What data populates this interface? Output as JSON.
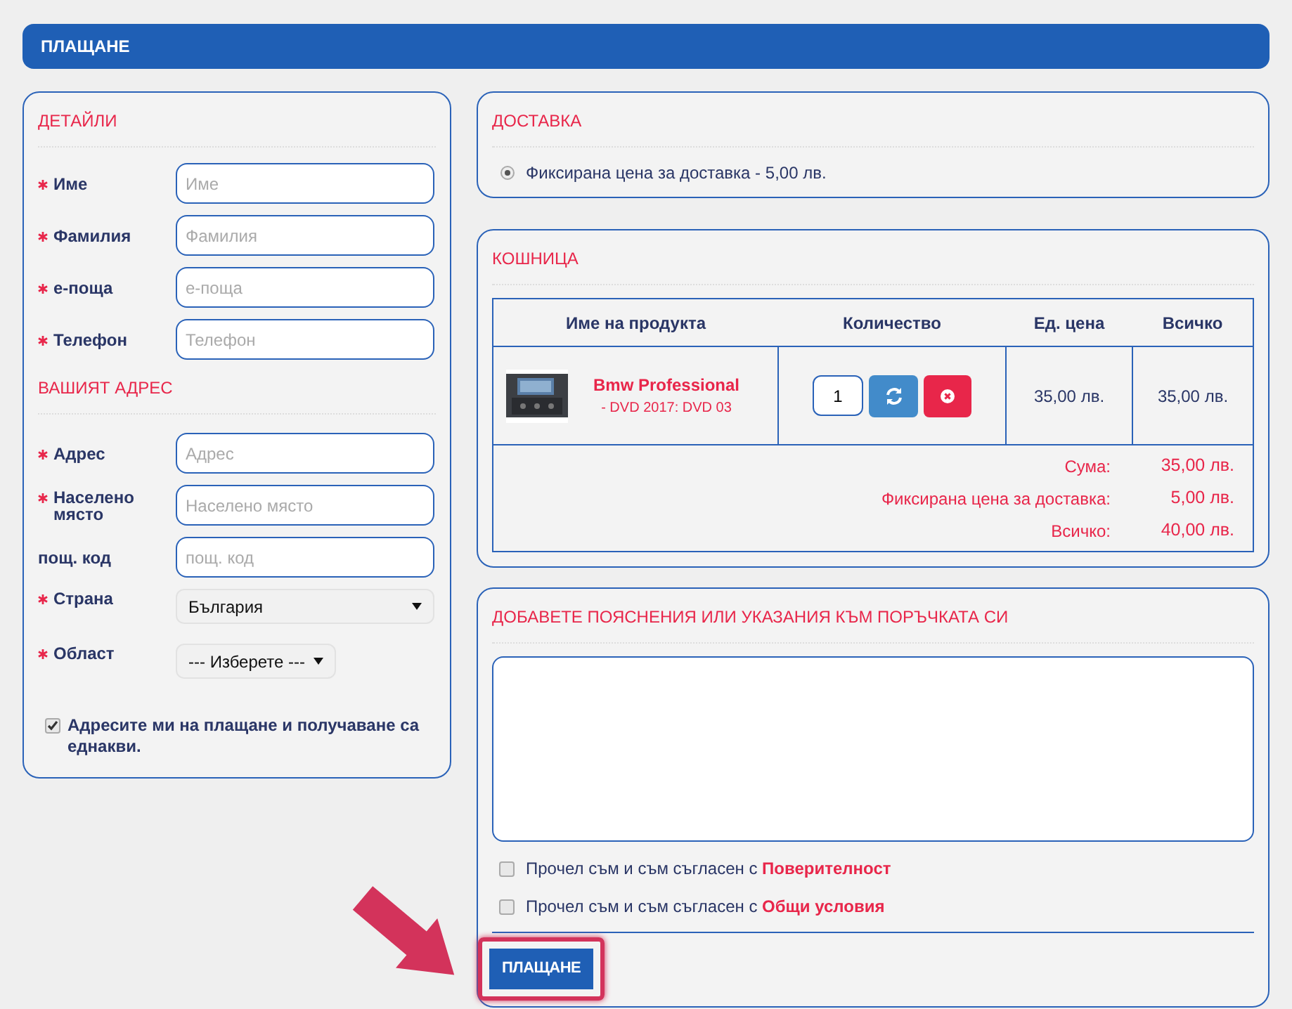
{
  "header": {
    "title": "ПЛАЩАНЕ"
  },
  "details": {
    "title": "ДЕТАЙЛИ",
    "fields": [
      {
        "label": "Име",
        "placeholder": "Име",
        "required": true
      },
      {
        "label": "Фамилия",
        "placeholder": "Фамилия",
        "required": true
      },
      {
        "label": "е-поща",
        "placeholder": "е-поща",
        "required": true
      },
      {
        "label": "Телефон",
        "placeholder": "Телефон",
        "required": true
      }
    ]
  },
  "address": {
    "title": "ВАШИЯТ АДРЕС",
    "fields": [
      {
        "kind": "text",
        "label": "Адрес",
        "placeholder": "Адрес",
        "required": true
      },
      {
        "kind": "text",
        "label": "Населено място",
        "placeholder": "Населено място",
        "required": true
      },
      {
        "kind": "text",
        "label": "пощ. код",
        "placeholder": "пощ. код",
        "required": false
      },
      {
        "kind": "select",
        "label": "Страна",
        "value": "България",
        "required": true,
        "wide": true
      },
      {
        "kind": "select",
        "label": "Област",
        "value": "--- Изберете ---",
        "required": true,
        "wide": false
      }
    ]
  },
  "same_address": {
    "label": "Адресите ми на плащане и получаване са еднакви.",
    "checked": true
  },
  "delivery": {
    "title": "ДОСТАВКА",
    "options": [
      {
        "label": "Фиксирана цена за доставка - 5,00 лв.",
        "selected": true
      }
    ]
  },
  "cart": {
    "title": "КОШНИЦА",
    "columns": [
      "Име на продукта",
      "Количество",
      "Ед. цена",
      "Всичко"
    ],
    "rows": [
      {
        "name": "Bmw Professional",
        "option": "- DVD 2017: DVD 03",
        "quantity": "1",
        "unit_price": "35,00 лв.",
        "total": "35,00 лв."
      }
    ],
    "summary": [
      {
        "label": "Сума:",
        "value": "35,00 лв."
      },
      {
        "label": "Фиксирана цена за доставка:",
        "value": "5,00 лв."
      },
      {
        "label": "Всичко:",
        "value": "40,00 лв."
      }
    ]
  },
  "notes": {
    "title": "ДОБАВЕТЕ ПОЯСНЕНИЯ ИЛИ УКАЗАНИЯ КЪМ ПОРЪЧКАТА СИ",
    "agreements": [
      {
        "text": "Прочел съм и съм съгласен с",
        "link": "Поверителност",
        "checked": false
      },
      {
        "text": "Прочел съм и съм съгласен с",
        "link": "Общи условия",
        "checked": false
      }
    ],
    "submit": "ПЛАЩАНЕ",
    "highlighted": true
  }
}
